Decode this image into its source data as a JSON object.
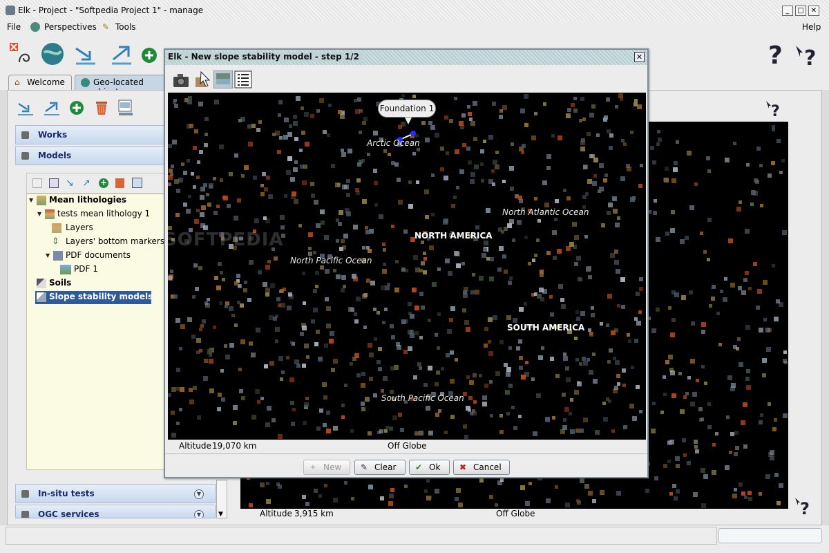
{
  "window": {
    "title": "Elk - Project - \"Softpedia Project 1\" - manage"
  },
  "menu": {
    "file": "File",
    "perspectives": "Perspectives",
    "tools": "Tools",
    "help": "Help"
  },
  "tabs": [
    {
      "label": "Welcome"
    },
    {
      "label": "Geo-located objects"
    }
  ],
  "sidebar": {
    "works": "Works",
    "models": "Models",
    "insitu": "In-situ tests",
    "ogc": "OGC services",
    "tree": {
      "mean_lithologies": "Mean lithologies",
      "tests_mean_lithology": "tests mean lithology 1",
      "layers": "Layers",
      "bottom_markers": "Layers' bottom markers",
      "pdf_documents": "PDF documents",
      "pdf1": "PDF 1",
      "soils": "Soils",
      "slope_models": "Slope stability models"
    }
  },
  "background_map": {
    "altitude_label": "Altitude",
    "altitude_value": "3,915 km",
    "status": "Off Globe"
  },
  "dialog": {
    "title": "Elk - New slope stability model - step 1/2",
    "map": {
      "callout": "Foundation 1",
      "labels": {
        "arctic": "Arctic Ocean",
        "north_atlantic": "North Atlantic Ocean",
        "north_america": "NORTH AMERICA",
        "north_pacific": "North Pacific Ocean",
        "south_america": "SOUTH AMERICA",
        "south_pacific": "South Pacific Ocean"
      },
      "watermark": "SOFTPEDIA"
    },
    "altitude_label": "Altitude",
    "altitude_value": "19,070 km",
    "status": "Off Globe",
    "buttons": {
      "new": "New",
      "clear": "Clear",
      "ok": "Ok",
      "cancel": "Cancel"
    }
  },
  "colors": {
    "selection": "#2f5a9a",
    "tree_bg": "#fbfbe4",
    "accordion": "#c8d8ee",
    "dialog_title": "#c0d4d8"
  }
}
